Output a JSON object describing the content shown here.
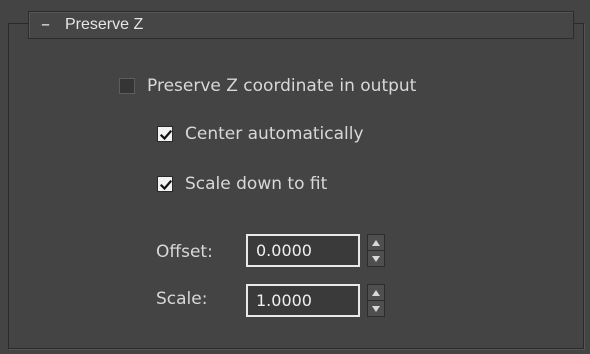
{
  "rollout": {
    "collapse_symbol": "–",
    "title": "Preserve Z"
  },
  "options": {
    "preserve_z": {
      "label": "Preserve Z coordinate in output",
      "checked": false
    },
    "center_automatically": {
      "label": "Center automatically",
      "checked": true
    },
    "scale_down_to_fit": {
      "label": "Scale down to fit",
      "checked": true
    }
  },
  "fields": {
    "offset": {
      "label": "Offset:",
      "value": "0.0000"
    },
    "scale": {
      "label": "Scale:",
      "value": "1.0000"
    }
  },
  "icons": {
    "collapse": "minus-icon",
    "check": "checkmark-icon",
    "spin_up": "triangle-up-icon",
    "spin_down": "triangle-down-icon"
  },
  "colors": {
    "background": "#444444",
    "text": "#d8d8d8",
    "field_border": "#e9e9e9",
    "checkbox_fill_checked": "#f2f2f2"
  }
}
